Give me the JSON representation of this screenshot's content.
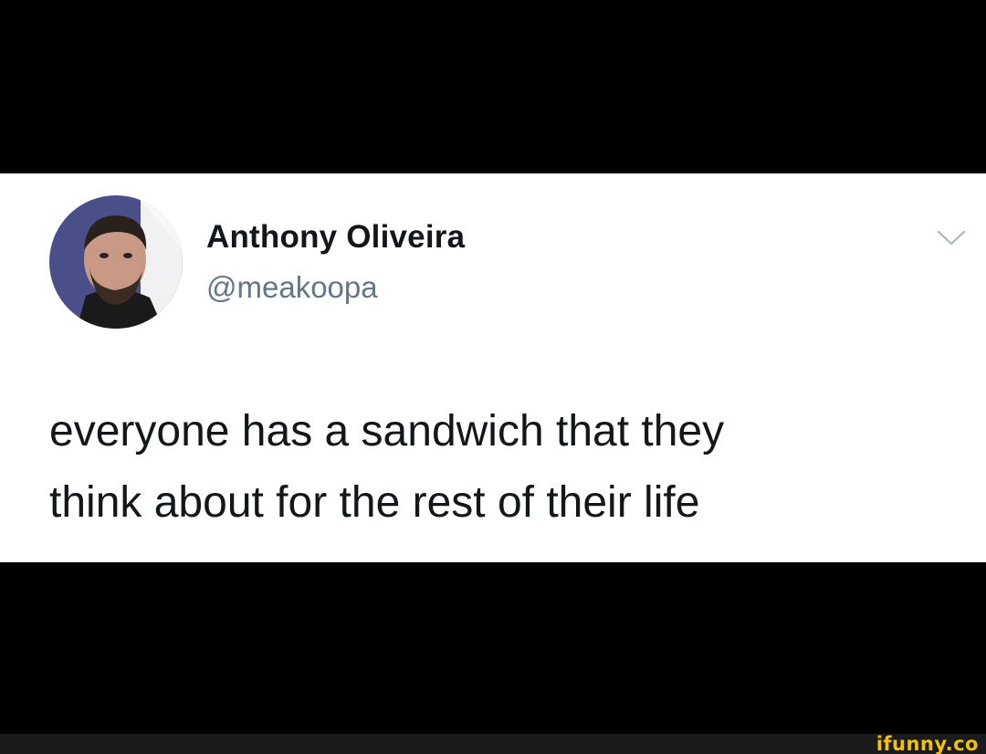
{
  "tweet": {
    "author_name": "Anthony Oliveira",
    "author_handle": "@meakoopa",
    "text_line_1": "everyone has a sandwich that they",
    "text_line_2": "think about for the rest of their life",
    "menu_icon": "chevron-down-icon",
    "avatar_icon": "avatar"
  },
  "watermark": {
    "text": "ifunny.co"
  },
  "colors": {
    "background": "#000000",
    "card": "#ffffff",
    "name": "#14171a",
    "handle": "#657786",
    "watermark": "#f2c200"
  }
}
